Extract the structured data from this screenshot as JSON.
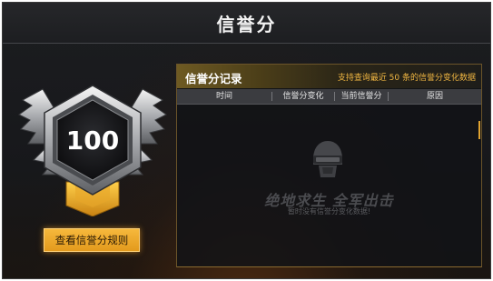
{
  "header": {
    "title": "信誉分"
  },
  "badge": {
    "score": "100"
  },
  "rules_button": {
    "label": "查看信誉分规则"
  },
  "record_panel": {
    "title": "信誉分记录",
    "note": "支持查询最近 50 条的信誉分变化数据",
    "columns": [
      "时间",
      "信誉分变化",
      "当前信誉分",
      "原因"
    ],
    "rows": [],
    "empty_state": {
      "icon": "helmet-icon",
      "game_title": "绝地求生 全军出击",
      "message": "暂时没有信誉分变化数据!"
    }
  },
  "colors": {
    "accent": "#f0b642",
    "button": "#e9a22a",
    "background": "#1a1b1e"
  }
}
